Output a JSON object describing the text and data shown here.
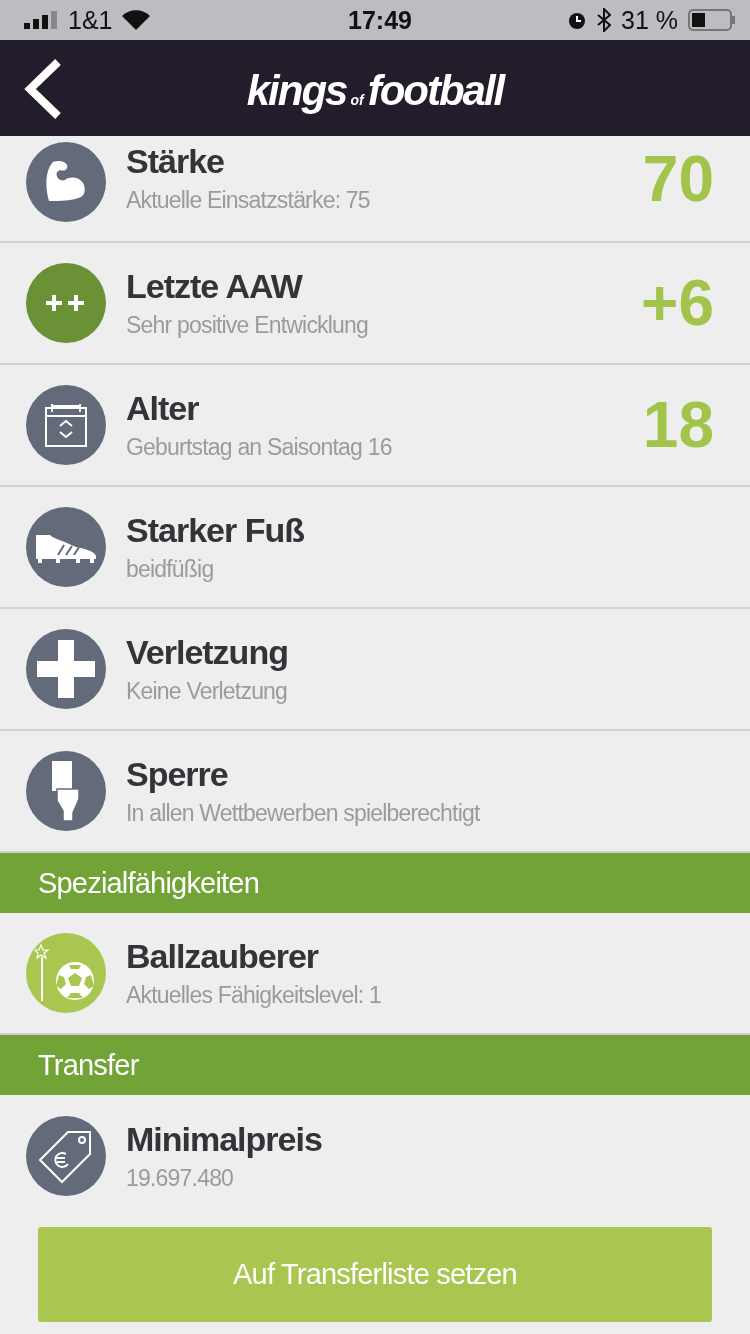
{
  "status_bar": {
    "carrier": "1&1",
    "time": "17:49",
    "battery": "31 %"
  },
  "header": {
    "logo": [
      "kings",
      "of",
      "football"
    ]
  },
  "sections": [
    {
      "items": [
        {
          "kind": "muscle",
          "color": "#636b7b",
          "title": "Stärke",
          "subtitle": "Aktuelle Einsatzstärke: 75",
          "value": "70"
        },
        {
          "kind": "plusplus",
          "color": "#6a9136",
          "title": "Letzte AAW",
          "subtitle": "Sehr positive Entwicklung",
          "value": "+6"
        },
        {
          "kind": "calendar",
          "color": "#636b7b",
          "title": "Alter",
          "subtitle": "Geburtstag an Saisontag 16",
          "value": "18"
        },
        {
          "kind": "shoe",
          "color": "#636b7b",
          "title": "Starker Fuß",
          "subtitle": "beidfüßig"
        },
        {
          "kind": "cross",
          "color": "#636b7b",
          "title": "Verletzung",
          "subtitle": "Keine Verletzung"
        },
        {
          "kind": "card",
          "color": "#636b7b",
          "title": "Sperre",
          "subtitle": "In allen Wettbewerben spielberechtigt"
        }
      ]
    },
    {
      "title": "Spezialfähigkeiten",
      "items": [
        {
          "kind": "wandball",
          "color": "#a8c650",
          "title": "Ballzauberer",
          "subtitle": "Aktuelles Fähigkeitslevel: 1"
        }
      ]
    },
    {
      "title": "Transfer",
      "items": [
        {
          "kind": "tag",
          "color": "#636b7b",
          "title": "Minimalpreis",
          "subtitle": "19.697.480"
        }
      ]
    }
  ],
  "action_button": "Auf Transferliste setzen"
}
